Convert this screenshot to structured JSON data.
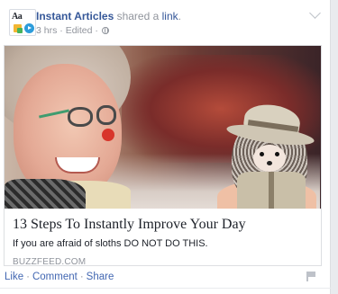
{
  "post": {
    "page_name": "Instant Articles",
    "shared_text": " shared a ",
    "link_word": "link",
    "period": ".",
    "time": "3 hrs",
    "meta_separator": " · ",
    "edited": "Edited",
    "privacy_icon": "globe-icon",
    "avatar_text": "Aa"
  },
  "attachment": {
    "title": "13 Steps To Instantly Improve Your Day",
    "description": "If you are afraid of sloths DO NOT DO THIS.",
    "domain": "BUZZFEED.COM"
  },
  "actions": {
    "like": "Like",
    "comment": "Comment",
    "share": "Share",
    "separator": "·"
  },
  "colors": {
    "link_blue": "#365899",
    "action_blue": "#4267b2",
    "muted_gray": "#90949c",
    "text_dark": "#1d2129"
  }
}
